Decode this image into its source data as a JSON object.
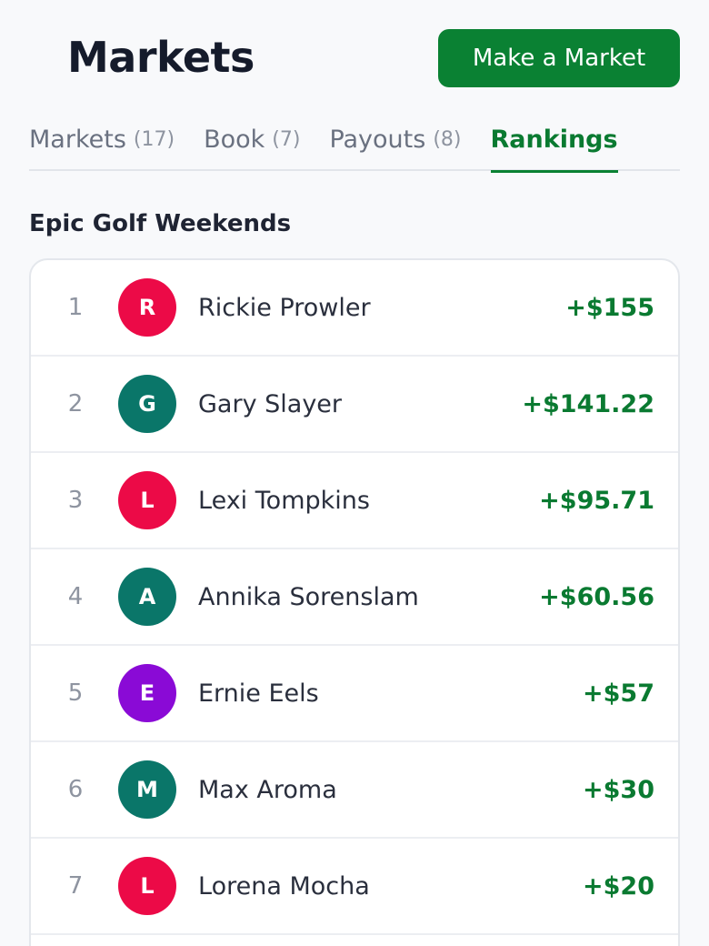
{
  "header": {
    "title": "Markets",
    "make_market_label": "Make a Market"
  },
  "tabs": [
    {
      "label": "Markets",
      "count": "(17)",
      "active": false
    },
    {
      "label": "Book",
      "count": "(7)",
      "active": false
    },
    {
      "label": "Payouts",
      "count": "(8)",
      "active": false
    },
    {
      "label": "Rankings",
      "count": "",
      "active": true
    }
  ],
  "section": {
    "title": "Epic Golf Weekends"
  },
  "rankings": [
    {
      "rank": "1",
      "initial": "R",
      "name": "Rickie Prowler",
      "payout": "+$155",
      "avatar_color": "#ec0a47"
    },
    {
      "rank": "2",
      "initial": "G",
      "name": "Gary Slayer",
      "payout": "+$141.22",
      "avatar_color": "#0a7669"
    },
    {
      "rank": "3",
      "initial": "L",
      "name": "Lexi Tompkins",
      "payout": "+$95.71",
      "avatar_color": "#ec0a47"
    },
    {
      "rank": "4",
      "initial": "A",
      "name": "Annika Sorenslam",
      "payout": "+$60.56",
      "avatar_color": "#0a7669"
    },
    {
      "rank": "5",
      "initial": "E",
      "name": "Ernie Eels",
      "payout": "+$57",
      "avatar_color": "#8a0ad6"
    },
    {
      "rank": "6",
      "initial": "M",
      "name": "Max Aroma",
      "payout": "+$30",
      "avatar_color": "#0a7669"
    },
    {
      "rank": "7",
      "initial": "L",
      "name": "Lorena Mocha",
      "payout": "+$20",
      "avatar_color": "#ec0a47"
    }
  ],
  "colors": {
    "accent_green": "#0a8133",
    "payout_green": "#0a7a31",
    "background": "#f8f9fb"
  }
}
